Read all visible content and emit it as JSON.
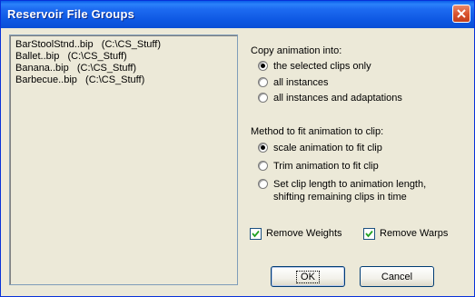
{
  "window": {
    "title": "Reservoir File Groups"
  },
  "file_list": [
    "BarStoolStnd..bip   (C:\\CS_Stuff)",
    "Ballet..bip   (C:\\CS_Stuff)",
    "Banana..bip   (C:\\CS_Stuff)",
    "Barbecue..bip   (C:\\CS_Stuff)"
  ],
  "copy_animation": {
    "label": "Copy animation into:",
    "options": [
      "the selected clips only",
      "all instances",
      "all instances and adaptations"
    ],
    "selected": 0
  },
  "fit_method": {
    "label": "Method to fit animation to clip:",
    "options": [
      "scale animation to fit clip",
      "Trim animation to fit clip",
      "Set clip length to animation length,",
      "shifting remaining clips in time"
    ],
    "selected": 0
  },
  "checkboxes": {
    "remove_weights": {
      "label": "Remove Weights",
      "checked": true
    },
    "remove_warps": {
      "label": "Remove Warps",
      "checked": true
    }
  },
  "buttons": {
    "ok": "OK",
    "cancel": "Cancel"
  }
}
